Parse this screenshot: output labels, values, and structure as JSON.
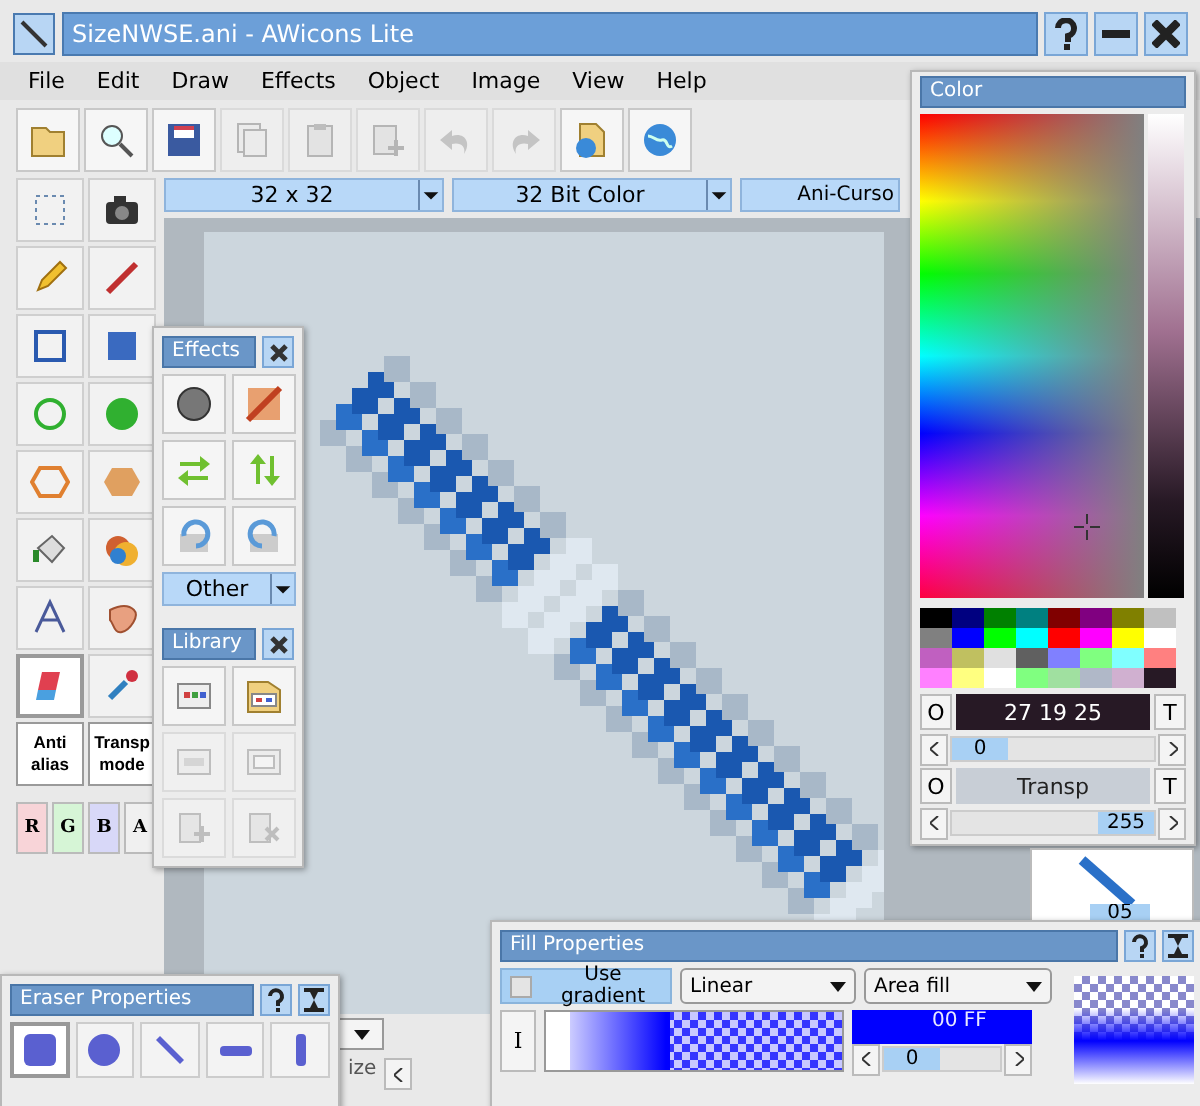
{
  "window": {
    "title": "SizeNWSE.ani - AWicons Lite"
  },
  "menu": [
    "File",
    "Edit",
    "Draw",
    "Effects",
    "Object",
    "Image",
    "View",
    "Help"
  ],
  "toolbar": [
    {
      "kind": "folder",
      "disabled": false
    },
    {
      "kind": "search",
      "disabled": false
    },
    {
      "kind": "save",
      "disabled": false
    },
    {
      "kind": "copy",
      "disabled": true
    },
    {
      "kind": "paste",
      "disabled": true
    },
    {
      "kind": "paste-new",
      "disabled": true
    },
    {
      "kind": "undo",
      "disabled": true
    },
    {
      "kind": "redo",
      "disabled": true
    },
    {
      "kind": "folder-globe",
      "disabled": false
    },
    {
      "kind": "globe",
      "disabled": false
    }
  ],
  "tools": [
    {
      "kind": "select",
      "selected": false
    },
    {
      "kind": "camera",
      "selected": false
    },
    {
      "kind": "pencil",
      "selected": false
    },
    {
      "kind": "line",
      "selected": false
    },
    {
      "kind": "rect",
      "selected": false
    },
    {
      "kind": "rect-filled",
      "selected": false
    },
    {
      "kind": "circle",
      "selected": false
    },
    {
      "kind": "circle-filled",
      "selected": false
    },
    {
      "kind": "hexagon",
      "selected": false
    },
    {
      "kind": "hexagon-filled",
      "selected": false
    },
    {
      "kind": "bucket",
      "selected": false
    },
    {
      "kind": "colorize",
      "selected": false
    },
    {
      "kind": "text",
      "selected": false
    },
    {
      "kind": "finger",
      "selected": false
    },
    {
      "kind": "eraser",
      "selected": true
    },
    {
      "kind": "dropper",
      "selected": false
    }
  ],
  "modes": [
    {
      "label": "Anti alias"
    },
    {
      "label": "Transp mode"
    }
  ],
  "channels": [
    {
      "label": "R",
      "color": "#f8d4d8"
    },
    {
      "label": "G",
      "color": "#d6f5d6"
    },
    {
      "label": "B",
      "color": "#d8d8f8"
    },
    {
      "label": "A",
      "color": "#f0f0f0"
    }
  ],
  "format_bar": [
    {
      "value": "32 x 32"
    },
    {
      "value": "32 Bit Color"
    },
    {
      "value": "Ani-Curso"
    }
  ],
  "size_bar": {
    "label": "ize"
  },
  "effects": {
    "title": "Effects",
    "buttons": [
      {
        "kind": "sphere"
      },
      {
        "kind": "checker"
      },
      {
        "kind": "swap-h"
      },
      {
        "kind": "swap-v"
      },
      {
        "kind": "rotate-l"
      },
      {
        "kind": "rotate-r"
      }
    ],
    "dropdown": "Other"
  },
  "library": {
    "title": "Library",
    "buttons": [
      {
        "kind": "lib",
        "disabled": false
      },
      {
        "kind": "lib-open",
        "disabled": false
      },
      {
        "kind": "lib-save",
        "disabled": true
      },
      {
        "kind": "lib-ico",
        "disabled": true
      },
      {
        "kind": "lib-add",
        "disabled": true
      },
      {
        "kind": "lib-del",
        "disabled": true
      }
    ]
  },
  "color": {
    "title": "Color",
    "swatches": [
      {
        "color": "#000000"
      },
      {
        "color": "#000080"
      },
      {
        "color": "#008000"
      },
      {
        "color": "#008080"
      },
      {
        "color": "#800000"
      },
      {
        "color": "#800080"
      },
      {
        "color": "#808000"
      },
      {
        "color": "#c0c0c0"
      },
      {
        "color": "#808080"
      },
      {
        "color": "#0000ff"
      },
      {
        "color": "#00ff00"
      },
      {
        "color": "#00ffff"
      },
      {
        "color": "#ff0000"
      },
      {
        "color": "#ff00ff"
      },
      {
        "color": "#ffff00"
      },
      {
        "color": "#ffffff"
      },
      {
        "color": "#c060c0"
      },
      {
        "color": "#c0c060"
      },
      {
        "color": "#e0e0e0"
      },
      {
        "color": "#606060"
      },
      {
        "color": "#8080ff"
      },
      {
        "color": "#80ff80"
      },
      {
        "color": "#80ffff"
      },
      {
        "color": "#ff8080"
      },
      {
        "color": "#ff80ff"
      },
      {
        "color": "#ffff80"
      },
      {
        "color": "#ffffff"
      },
      {
        "color": "#80ff80"
      },
      {
        "color": "#a0e0a0"
      },
      {
        "color": "#b0b8c8"
      },
      {
        "color": "#d0b0d0"
      },
      {
        "color": "#271925"
      }
    ],
    "rows": [
      {
        "kind": "color",
        "left": "O",
        "value": "27 19 25",
        "right": "T",
        "slider": {
          "level": 0,
          "reading": "0"
        }
      },
      {
        "kind": "transparency",
        "left": "O",
        "value": "Transp",
        "right": "T",
        "slider": {
          "level": 1,
          "reading": "255"
        }
      }
    ]
  },
  "preview": {
    "spin": "05"
  },
  "eraser": {
    "title": "Eraser Properties",
    "shapes": [
      {
        "kind": "square",
        "selected": true
      },
      {
        "kind": "round",
        "selected": false
      },
      {
        "kind": "diagonal",
        "selected": false
      },
      {
        "kind": "horizontal",
        "selected": false
      },
      {
        "kind": "vertical",
        "selected": false
      }
    ]
  },
  "fill": {
    "title": "Fill Properties",
    "use_gradient": {
      "label": "Use gradient",
      "checked": false
    },
    "type": "Linear",
    "mode": "Area fill",
    "i_button": "I",
    "color_value": "00 FF",
    "level": 0,
    "reading": "0"
  }
}
